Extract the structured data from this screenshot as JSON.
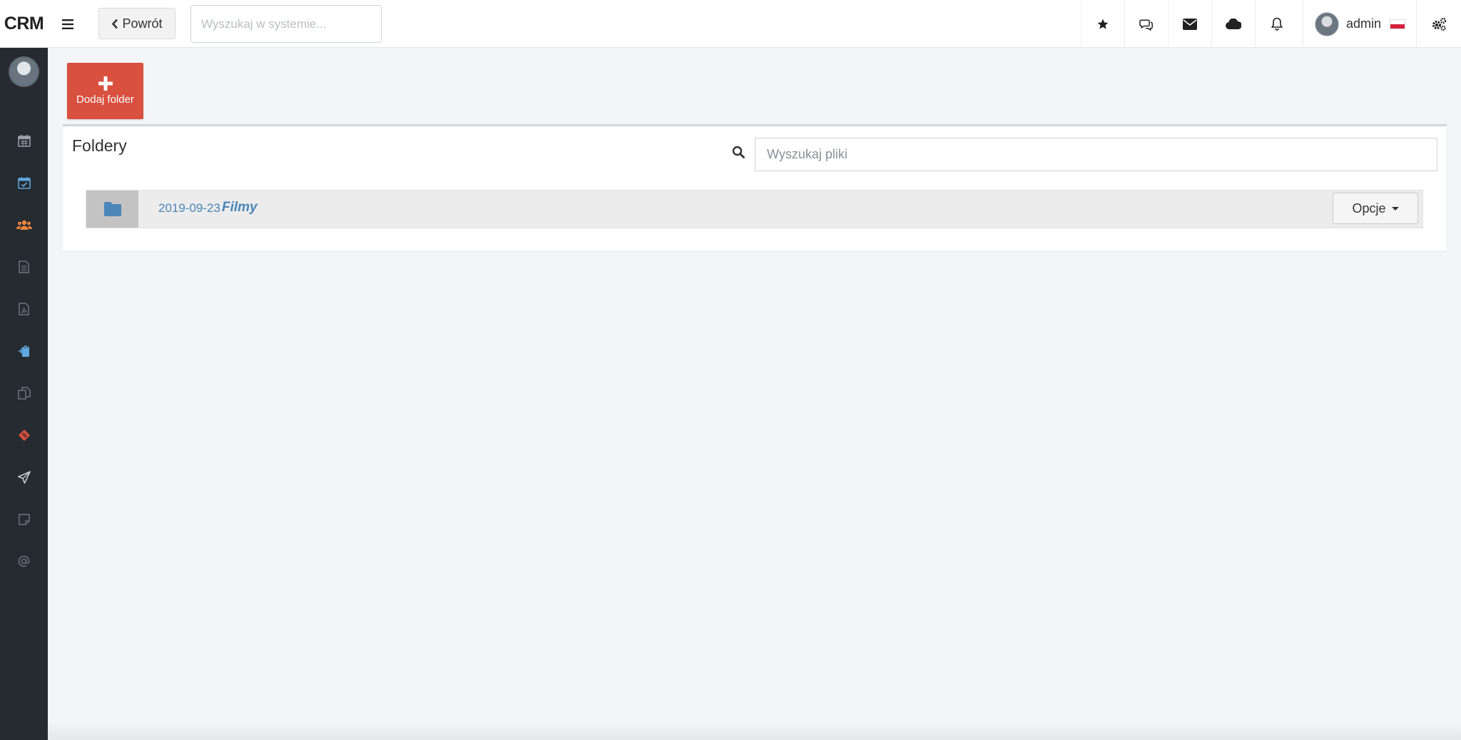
{
  "app": {
    "logo": "CRM"
  },
  "header": {
    "back_label": "Powrót",
    "search_placeholder": "Wyszukaj w systemie...",
    "icons": [
      "star-icon",
      "comments-icon",
      "envelope-icon",
      "cloud-icon",
      "bell-icon"
    ],
    "user": {
      "name": "admin",
      "language_flag": "pl"
    },
    "settings_icon": "gears-icon"
  },
  "sidebar": {
    "items": [
      {
        "icon": "calendar-icon",
        "color": "#9aa3ab"
      },
      {
        "icon": "calendar-check-icon",
        "color": "#5fa7dd"
      },
      {
        "icon": "users-icon",
        "color": "#f0843c"
      },
      {
        "icon": "document-icon",
        "color": "#6c757d"
      },
      {
        "icon": "pdf-file-icon",
        "color": "#6c757d"
      },
      {
        "icon": "clipboard-icon",
        "color": "#5fa7dd"
      },
      {
        "icon": "copy-icon",
        "color": "#6c757d"
      },
      {
        "icon": "ticket-icon",
        "color": "#d9503f"
      },
      {
        "icon": "paper-plane-icon",
        "color": "#c5cbd0"
      },
      {
        "icon": "sticky-note-icon",
        "color": "#6c757d"
      },
      {
        "icon": "at-icon",
        "color": "#6c757d"
      }
    ]
  },
  "toolbar": {
    "add_folder_label": "Dodaj folder"
  },
  "folders": {
    "title": "Foldery",
    "search_placeholder": "Wyszukaj pliki",
    "items": [
      {
        "date": "2019-09-23",
        "name": "Filmy",
        "options_label": "Opcje"
      }
    ]
  },
  "colors": {
    "accent_red": "#d9503f",
    "link_blue": "#4a86b8",
    "sidebar_bg": "#252b31"
  }
}
